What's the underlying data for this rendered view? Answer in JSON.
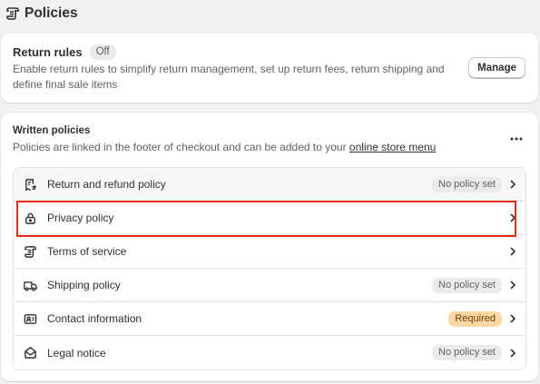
{
  "header": {
    "title": "Policies",
    "icon": "policy-scroll-icon"
  },
  "return_rules": {
    "title": "Return rules",
    "status_badge": "Off",
    "description": "Enable return rules to simplify return management, set up return fees, return shipping and define final sale items",
    "manage_label": "Manage"
  },
  "written_policies": {
    "title": "Written policies",
    "description_prefix": "Policies are linked in the footer of checkout and can be added to your ",
    "description_link": "online store menu",
    "more_icon": "more-horizontal-icon",
    "items": [
      {
        "label": "Return and refund policy",
        "icon": "return-receipt-icon",
        "badge": "No policy set",
        "badge_tone": "neutral"
      },
      {
        "label": "Privacy policy",
        "icon": "lock-icon",
        "badge": "",
        "badge_tone": ""
      },
      {
        "label": "Terms of service",
        "icon": "scroll-icon",
        "badge": "",
        "badge_tone": ""
      },
      {
        "label": "Shipping policy",
        "icon": "truck-icon",
        "badge": "No policy set",
        "badge_tone": "neutral"
      },
      {
        "label": "Contact information",
        "icon": "contact-card-icon",
        "badge": "Required",
        "badge_tone": "attention"
      },
      {
        "label": "Legal notice",
        "icon": "envelope-open-icon",
        "badge": "No policy set",
        "badge_tone": "neutral"
      }
    ]
  },
  "colors": {
    "page_background": "#f1f1f1",
    "card_background": "#ffffff",
    "highlight": "#e02a1b",
    "required_badge": "#ffd6a4",
    "neutral_badge": "#ebebeb"
  }
}
